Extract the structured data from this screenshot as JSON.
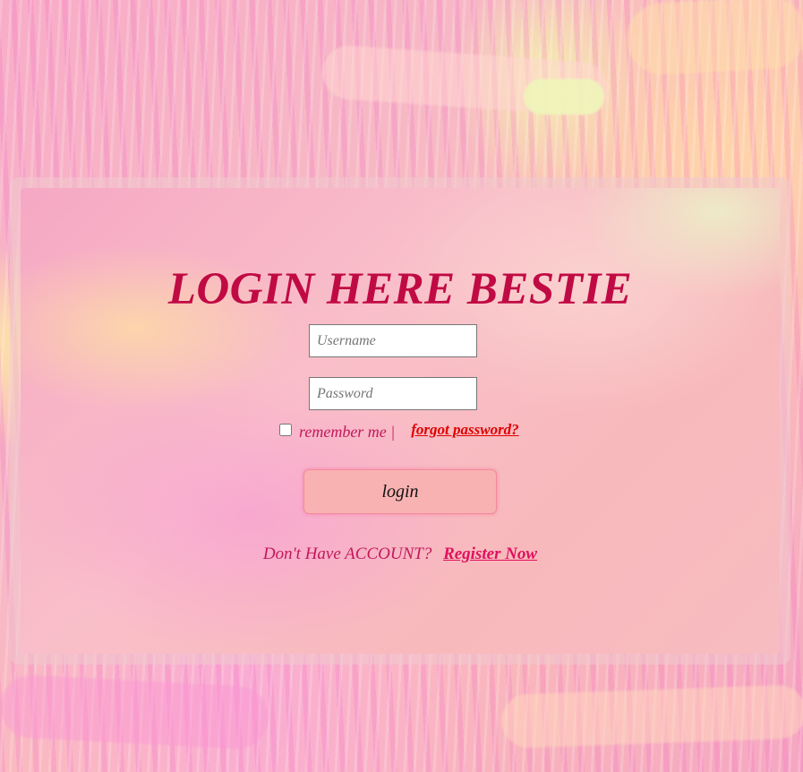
{
  "login": {
    "title": "LOGIN HERE BESTIE",
    "username_placeholder": "Username",
    "password_placeholder": "Password",
    "remember_label": "remember me |",
    "forgot_link": "forgot password?",
    "login_button": "login",
    "register_prompt": "Don't Have ACCOUNT?",
    "register_link": "Register Now"
  },
  "colors": {
    "title": "#c00a44",
    "link_red": "#e00000",
    "register_link": "#e0115f",
    "button_bg": "#f8b2b2"
  }
}
